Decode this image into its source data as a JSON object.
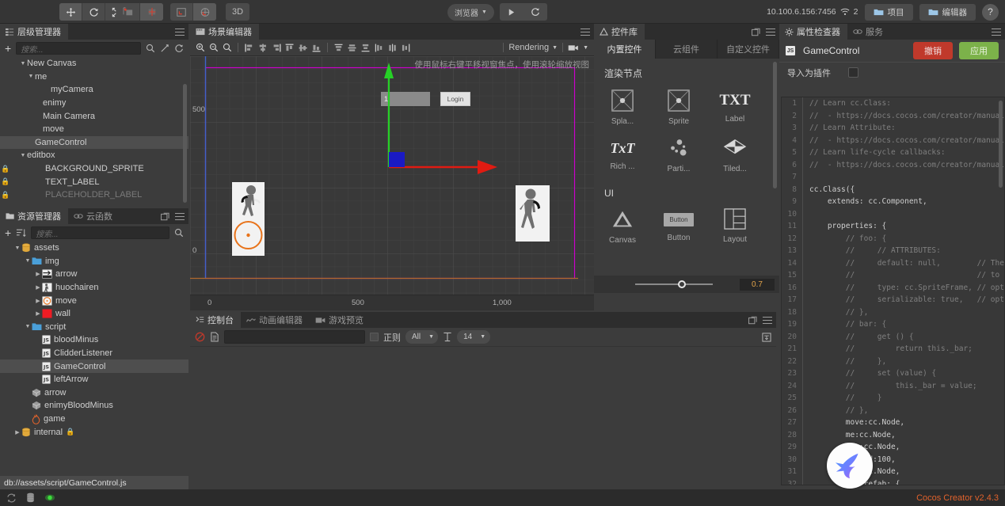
{
  "toolbar": {
    "transform_tools": [
      "move-tool",
      "rotate-tool",
      "scale-tool",
      "rect-tool"
    ],
    "pivot_tools": [
      "pivot-center-tool",
      "pivot-pivot-tool"
    ],
    "coord_tools": [
      "local-coord-tool",
      "global-coord-tool"
    ],
    "mode_3d_label": "3D",
    "preview_target_label": "浏览器",
    "play_label": "play-button",
    "refresh_label": "refresh-button",
    "ip_address": "10.100.6.156:7456",
    "device_count": "2",
    "project_button": "项目",
    "editor_button": "编辑器",
    "help_button": "?"
  },
  "hierarchy": {
    "tab_label": "层级管理器",
    "search_placeholder": "搜索...",
    "nodes": [
      {
        "label": "New Canvas",
        "depth": 1,
        "arrow": "down",
        "locked": false,
        "selected": false,
        "dim": false
      },
      {
        "label": "me",
        "depth": 2,
        "arrow": "down",
        "locked": false,
        "selected": false,
        "dim": false
      },
      {
        "label": "myCamera",
        "depth": 4,
        "arrow": "none",
        "locked": false,
        "selected": false,
        "dim": false
      },
      {
        "label": "enimy",
        "depth": 3,
        "arrow": "none",
        "locked": false,
        "selected": false,
        "dim": false
      },
      {
        "label": "Main Camera",
        "depth": 3,
        "arrow": "none",
        "locked": false,
        "selected": false,
        "dim": false
      },
      {
        "label": "move",
        "depth": 3,
        "arrow": "none",
        "locked": false,
        "selected": false,
        "dim": false
      },
      {
        "label": "GameControl",
        "depth": 2,
        "arrow": "none",
        "locked": false,
        "selected": true,
        "dim": false
      },
      {
        "label": "editbox",
        "depth": 1,
        "arrow": "down",
        "locked": false,
        "selected": false,
        "dim": false
      },
      {
        "label": "BACKGROUND_SPRITE",
        "depth": 3,
        "arrow": "none",
        "locked": true,
        "selected": false,
        "dim": false
      },
      {
        "label": "TEXT_LABEL",
        "depth": 3,
        "arrow": "none",
        "locked": true,
        "selected": false,
        "dim": false
      },
      {
        "label": "PLACEHOLDER_LABEL",
        "depth": 3,
        "arrow": "none",
        "locked": true,
        "selected": false,
        "dim": true
      }
    ]
  },
  "assets": {
    "tab_label": "资源管理器",
    "tab2_label": "云函数",
    "search_placeholder": "搜索...",
    "nodes": [
      {
        "label": "assets",
        "depth": 1,
        "arrow": "down",
        "icon": "db",
        "selected": false
      },
      {
        "label": "img",
        "depth": 2,
        "arrow": "down",
        "icon": "folder",
        "selected": false
      },
      {
        "label": "arrow",
        "depth": 3,
        "arrow": "right",
        "icon": "img-arrow",
        "selected": false
      },
      {
        "label": "huochairen",
        "depth": 3,
        "arrow": "right",
        "icon": "img-person",
        "selected": false
      },
      {
        "label": "move",
        "depth": 3,
        "arrow": "right",
        "icon": "img-circle",
        "selected": false
      },
      {
        "label": "wall",
        "depth": 3,
        "arrow": "right",
        "icon": "img-red",
        "selected": false
      },
      {
        "label": "script",
        "depth": 2,
        "arrow": "down",
        "icon": "folder",
        "selected": false
      },
      {
        "label": "bloodMinus",
        "depth": 3,
        "arrow": "none",
        "icon": "js",
        "selected": false
      },
      {
        "label": "ClidderListener",
        "depth": 3,
        "arrow": "none",
        "icon": "js",
        "selected": false
      },
      {
        "label": "GameControl",
        "depth": 3,
        "arrow": "none",
        "icon": "js",
        "selected": true
      },
      {
        "label": "leftArrow",
        "depth": 3,
        "arrow": "none",
        "icon": "js",
        "selected": false
      },
      {
        "label": "arrow",
        "depth": 2,
        "arrow": "none",
        "icon": "prefab",
        "selected": false
      },
      {
        "label": "enimyBloodMinus",
        "depth": 2,
        "arrow": "none",
        "icon": "prefab",
        "selected": false
      },
      {
        "label": "game",
        "depth": 2,
        "arrow": "none",
        "icon": "fire",
        "selected": false
      },
      {
        "label": "internal",
        "depth": 1,
        "arrow": "right",
        "icon": "db",
        "selected": false,
        "lock_suffix": true
      }
    ],
    "path_bar": "db://assets/script/GameControl.js"
  },
  "scene": {
    "tab_label": "场景编辑器",
    "hint_text": "使用鼠标右键平移视窗焦点，使用滚轮缩放视图",
    "rendering_label": "Rendering",
    "editbox_value": "1",
    "login_button_label": "Login",
    "ruler_y_labels": [
      "500",
      "0"
    ],
    "ruler_x_labels": [
      "0",
      "500",
      "1,000"
    ]
  },
  "console": {
    "tab_label": "控制台",
    "tab2_label": "动画编辑器",
    "tab3_label": "游戏预览",
    "regex_label": "正则",
    "filter_value": "All",
    "fontsize_value": "14",
    "search_value": ""
  },
  "widgets": {
    "tab_label": "控件库",
    "tabs": [
      "内置控件",
      "云组件",
      "自定义控件"
    ],
    "active_tab": "内置控件",
    "section1_title": "渲染节点",
    "section1_items": [
      "Spla...",
      "Sprite",
      "Label",
      "Rich ...",
      "Parti...",
      "Tiled..."
    ],
    "section2_title": "UI",
    "section2_items": [
      "Canvas",
      "Button",
      "Layout"
    ],
    "button_glyph": "Button",
    "label_glyph": "TXT",
    "rich_glyph": "TxT",
    "slider_value": "0.7"
  },
  "inspector": {
    "tab_label": "属性检查器",
    "tab2_label": "服务",
    "component_name": "GameControl",
    "revert_button": "撤销",
    "apply_button": "应用",
    "plugin_label": "导入为插件",
    "code_lines": [
      {
        "n": "1",
        "text": "// Learn cc.Class:",
        "kind": "com",
        "indent": 0
      },
      {
        "n": "2",
        "text": "//  - https://docs.cocos.com/creator/manual",
        "kind": "com",
        "indent": 0
      },
      {
        "n": "3",
        "text": "// Learn Attribute:",
        "kind": "com",
        "indent": 0
      },
      {
        "n": "4",
        "text": "//  - https://docs.cocos.com/creator/manual",
        "kind": "com",
        "indent": 0
      },
      {
        "n": "5",
        "text": "// Learn life-cycle callbacks:",
        "kind": "com",
        "indent": 0
      },
      {
        "n": "6",
        "text": "//  - https://docs.cocos.com/creator/manual",
        "kind": "com",
        "indent": 0
      },
      {
        "n": "7",
        "text": "",
        "kind": "code",
        "indent": 0
      },
      {
        "n": "8",
        "text": "cc.Class({",
        "kind": "code",
        "indent": 0
      },
      {
        "n": "9",
        "text": "    extends: cc.Component,",
        "kind": "code",
        "indent": 0
      },
      {
        "n": "10",
        "text": "",
        "kind": "code",
        "indent": 0
      },
      {
        "n": "11",
        "text": "    properties: {",
        "kind": "code",
        "indent": 0
      },
      {
        "n": "12",
        "text": "        // foo: {",
        "kind": "com",
        "indent": 0
      },
      {
        "n": "13",
        "text": "        //     // ATTRIBUTES:",
        "kind": "com",
        "indent": 0
      },
      {
        "n": "14",
        "text": "        //     default: null,        // The",
        "kind": "com",
        "indent": 0
      },
      {
        "n": "15",
        "text": "        //                           // to",
        "kind": "com",
        "indent": 0
      },
      {
        "n": "16",
        "text": "        //     type: cc.SpriteFrame, // opt",
        "kind": "com",
        "indent": 0
      },
      {
        "n": "17",
        "text": "        //     serializable: true,   // opt",
        "kind": "com",
        "indent": 0
      },
      {
        "n": "18",
        "text": "        // },",
        "kind": "com",
        "indent": 0
      },
      {
        "n": "19",
        "text": "        // bar: {",
        "kind": "com",
        "indent": 0
      },
      {
        "n": "20",
        "text": "        //     get () {",
        "kind": "com",
        "indent": 0
      },
      {
        "n": "21",
        "text": "        //         return this._bar;",
        "kind": "com",
        "indent": 0
      },
      {
        "n": "22",
        "text": "        //     },",
        "kind": "com",
        "indent": 0
      },
      {
        "n": "23",
        "text": "        //     set (value) {",
        "kind": "com",
        "indent": 0
      },
      {
        "n": "24",
        "text": "        //         this._bar = value;",
        "kind": "com",
        "indent": 0
      },
      {
        "n": "25",
        "text": "        //     }",
        "kind": "com",
        "indent": 0
      },
      {
        "n": "26",
        "text": "        // },",
        "kind": "com",
        "indent": 0
      },
      {
        "n": "27",
        "text": "        move:cc.Node,",
        "kind": "code",
        "indent": 0
      },
      {
        "n": "28",
        "text": "        me:cc.Node,",
        "kind": "code",
        "indent": 0
      },
      {
        "n": "29",
        "text": "        ___:cc.Node,",
        "kind": "code",
        "indent": 0
      },
      {
        "n": "30",
        "text": "        ___eed:100,",
        "kind": "code",
        "indent": 0
      },
      {
        "n": "31",
        "text": "        ___:cc.Node,",
        "kind": "code",
        "indent": 0
      },
      {
        "n": "32",
        "text": "        ___Prefab: {",
        "kind": "code",
        "indent": 0
      }
    ]
  },
  "statusbar": {
    "version": "Cocos Creator v2.4.3",
    "icons": [
      "sync-icon",
      "database-icon",
      "status-dot-icon"
    ]
  }
}
